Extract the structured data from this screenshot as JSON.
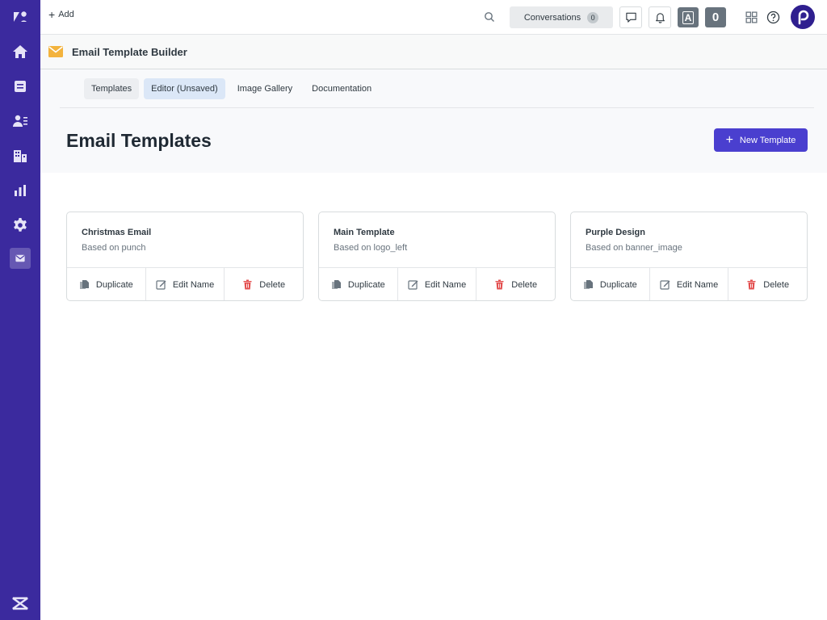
{
  "topbar": {
    "add_label": "Add",
    "conversations_label": "Conversations",
    "conversations_count": "0",
    "badge_a": "A",
    "badge_o": "0"
  },
  "app": {
    "title": "Email Template Builder"
  },
  "tabs": [
    {
      "label": "Templates"
    },
    {
      "label": "Editor (Unsaved)"
    },
    {
      "label": "Image Gallery"
    },
    {
      "label": "Documentation"
    }
  ],
  "page": {
    "title": "Email Templates",
    "new_button_label": "New Template"
  },
  "cards": [
    {
      "name": "Christmas Email",
      "subtitle": "Based on punch"
    },
    {
      "name": "Main Template",
      "subtitle": "Based on logo_left"
    },
    {
      "name": "Purple Design",
      "subtitle": "Based on banner_image"
    }
  ],
  "card_actions": {
    "duplicate": "Duplicate",
    "edit_name": "Edit Name",
    "delete": "Delete"
  },
  "colors": {
    "sidebar": "#3b2a9e",
    "primary_button": "#4a3fcf",
    "delete_icon": "#e34f4f",
    "email_icon": "#f3b33d"
  }
}
